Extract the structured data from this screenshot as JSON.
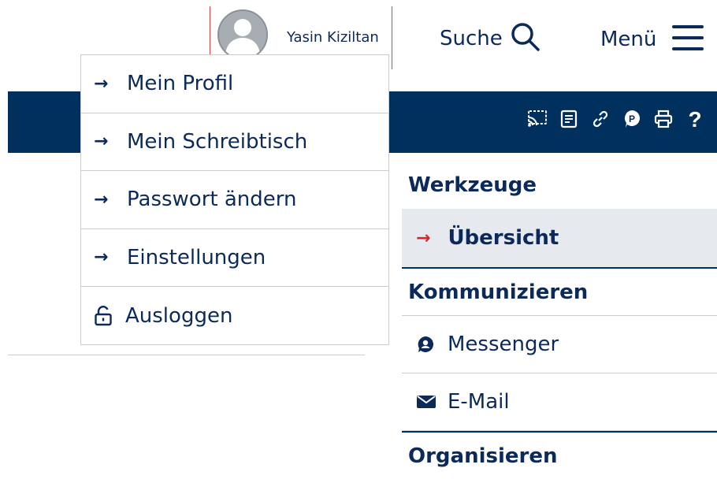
{
  "header": {
    "user_name": "Yasin Kiziltan",
    "search_label": "Suche",
    "menu_label": "Menü"
  },
  "toolbar": {
    "icons": [
      "cast-icon",
      "notes-icon",
      "link-icon",
      "parking-info-icon",
      "print-icon",
      "help-icon"
    ]
  },
  "user_menu": {
    "items": [
      {
        "label": "Mein Profil",
        "icon": "arrow-right-icon"
      },
      {
        "label": "Mein Schreibtisch",
        "icon": "arrow-right-icon"
      },
      {
        "label": "Passwort ändern",
        "icon": "arrow-right-icon"
      },
      {
        "label": "Einstellungen",
        "icon": "arrow-right-icon"
      },
      {
        "label": "Ausloggen",
        "icon": "unlock-icon"
      }
    ]
  },
  "sidebar": {
    "section1_heading": "Werkzeuge",
    "overview_label": "Übersicht",
    "section2_heading": "Kommunizieren",
    "messenger_label": "Messenger",
    "email_label": "E-Mail",
    "section3_heading": "Organisieren"
  },
  "colors": {
    "primary": "#00305e",
    "accent_red": "#d8242b",
    "active_bg": "#e6e9ee"
  }
}
